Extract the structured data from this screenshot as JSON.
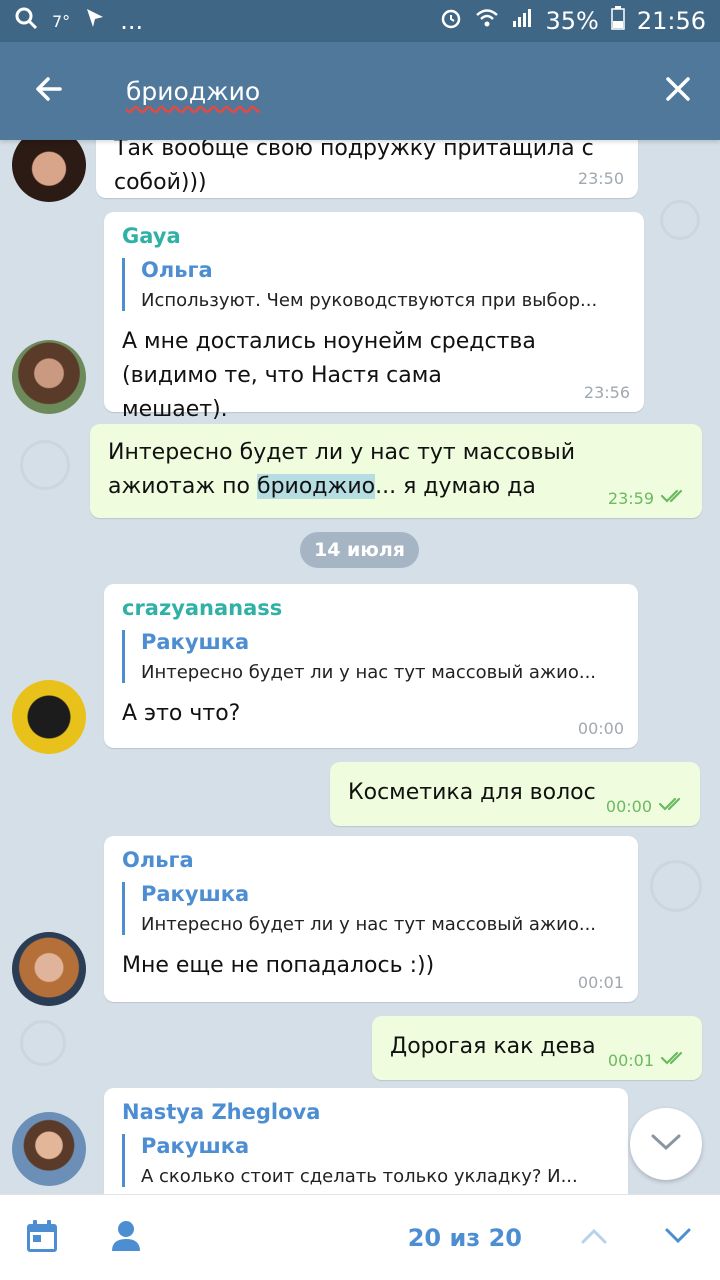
{
  "status_bar": {
    "temperature": "7°",
    "ellipsis": "...",
    "battery": "35%",
    "time": "21:56"
  },
  "header": {
    "search_query": "бриоджио",
    "back_icon": "arrow-left-icon",
    "close_icon": "close-icon"
  },
  "messages": [
    {
      "type": "incoming",
      "text": "Так вообще свою подружку притащила с собой)))",
      "time": "23:50"
    },
    {
      "type": "incoming",
      "sender": "Gaya",
      "sender_color": "#2fb1a6",
      "reply_name": "Ольга",
      "reply_text": "Используют. Чем руководствуются при выбор...",
      "text": "А мне достались ноунейм средства (видимо те, что Настя сама мешает).",
      "time": "23:56"
    },
    {
      "type": "outgoing",
      "text_before": "Интересно будет ли у нас тут массовый ажиотаж по ",
      "highlight": "бриоджио",
      "text_after": "... я думаю да",
      "time": "23:59"
    },
    {
      "type": "date",
      "text": "14 июля"
    },
    {
      "type": "incoming",
      "sender": "crazyananass",
      "sender_color": "#2fb1a6",
      "reply_name": "Ракушка",
      "reply_text": "Интересно будет ли у нас тут массовый ажио...",
      "text": "А это что?",
      "time": "00:00"
    },
    {
      "type": "outgoing",
      "text": "Косметика для волос",
      "time": "00:00"
    },
    {
      "type": "incoming",
      "sender": "Ольга",
      "sender_color": "#4d8ed3",
      "reply_name": "Ракушка",
      "reply_text": "Интересно будет ли у нас тут массовый ажио...",
      "text": "Мне еще не попадалось :))",
      "time": "00:01"
    },
    {
      "type": "outgoing",
      "text": "Дорогая как дева",
      "time": "00:01"
    },
    {
      "type": "incoming",
      "sender": "Nastya Zheglova",
      "sender_color": "#4d8ed3",
      "reply_name": "Ракушка",
      "reply_text": "А сколько стоит сделать только укладку? И...",
      "text": ""
    }
  ],
  "bottom_bar": {
    "counter": "20 из 20",
    "calendar_icon": "calendar-icon",
    "user_icon": "user-icon",
    "up_icon": "chevron-up-icon",
    "down_icon": "chevron-down-icon"
  },
  "colors": {
    "header": "#50789b",
    "status_bar": "#3f6684",
    "accent": "#4d8ed3",
    "outgoing_bubble": "#effdde",
    "chat_background": "#d5dfe8"
  }
}
